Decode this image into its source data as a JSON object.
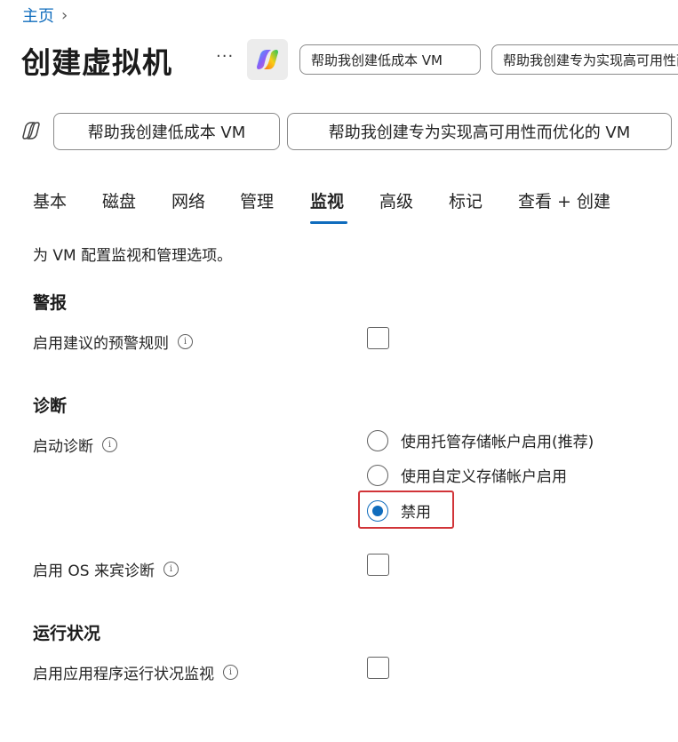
{
  "breadcrumb": {
    "home": "主页",
    "chevron": "chevron-right-icon"
  },
  "header": {
    "title": "创建虚拟机",
    "more": "···",
    "copilot_icon": "copilot-icon",
    "pills": [
      "帮助我创建低成本 VM",
      "帮助我创建专为实现高可用性而优化的 VM"
    ]
  },
  "suggestions": {
    "icon": "copilot-outline-icon",
    "items": [
      "帮助我创建低成本 VM",
      "帮助我创建专为实现高可用性而优化的 VM"
    ]
  },
  "tabs": [
    {
      "label": "基本",
      "active": false
    },
    {
      "label": "磁盘",
      "active": false
    },
    {
      "label": "网络",
      "active": false
    },
    {
      "label": "管理",
      "active": false
    },
    {
      "label": "监视",
      "active": true
    },
    {
      "label": "高级",
      "active": false
    },
    {
      "label": "标记",
      "active": false
    },
    {
      "label": "查看 + 创建",
      "active": false
    }
  ],
  "description": "为 VM 配置监视和管理选项。",
  "alerts": {
    "heading": "警报",
    "enable_label": "启用建议的预警规则",
    "enable_checked": false
  },
  "diagnostics": {
    "heading": "诊断",
    "boot_label": "启动诊断",
    "options": [
      {
        "label": "使用托管存储帐户启用(推荐)",
        "selected": false
      },
      {
        "label": "使用自定义存储帐户启用",
        "selected": false
      },
      {
        "label": "禁用",
        "selected": true
      }
    ],
    "guest_os_label": "启用 OS 来宾诊断",
    "guest_os_checked": false
  },
  "health": {
    "heading": "运行状况",
    "monitor_label": "启用应用程序运行状况监视",
    "monitor_checked": false
  },
  "colors": {
    "accent": "#0f6cbd",
    "highlight": "#d13438"
  }
}
